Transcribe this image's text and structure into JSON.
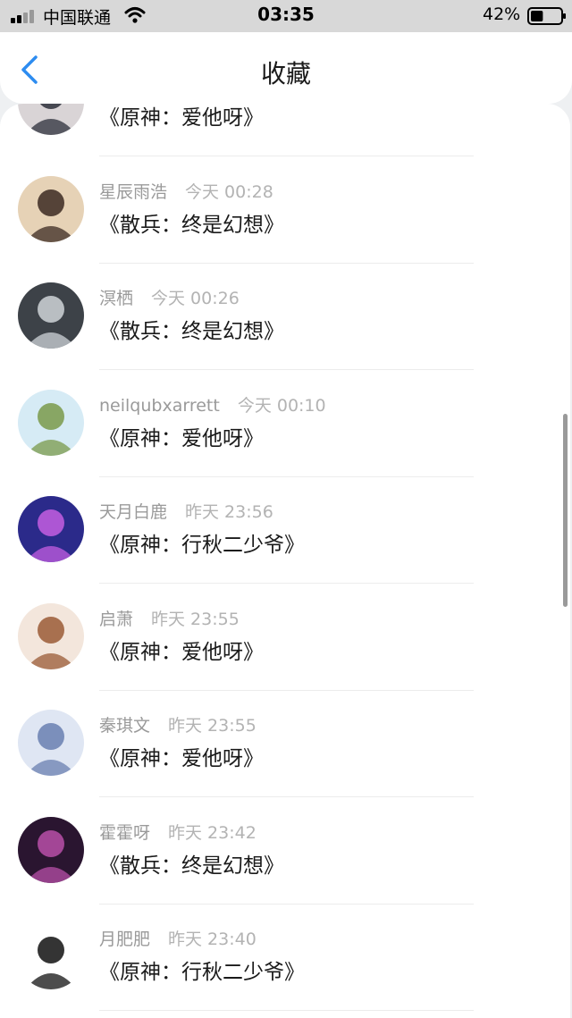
{
  "status_bar": {
    "carrier": "中国联通",
    "time": "03:35",
    "battery": "42%",
    "battery_level": 0.42
  },
  "nav": {
    "title": "收藏",
    "back_icon": "chevron-left-icon"
  },
  "colors": {
    "accent": "#2d8cf0",
    "divider": "#ececec"
  },
  "items": [
    {
      "user": "",
      "time": "",
      "work": "《原神：爱他呀》",
      "avatar": {
        "bg": "#d9d4d6",
        "fg": "#2b2f3a"
      }
    },
    {
      "user": "星辰雨浩",
      "time": "今天 00:28",
      "work": "《散兵：终是幻想》",
      "avatar": {
        "bg": "#e6d2b6",
        "fg": "#3b2a22"
      }
    },
    {
      "user": "溟栖",
      "time": "今天 00:26",
      "work": "《散兵：终是幻想》",
      "avatar": {
        "bg": "#3d4248",
        "fg": "#cfd4d8"
      }
    },
    {
      "user": "neilqubxarrett",
      "time": "今天 00:10",
      "work": "《原神：爱他呀》",
      "avatar": {
        "bg": "#d6ebf5",
        "fg": "#7a9a4a"
      }
    },
    {
      "user": "天月白鹿",
      "time": "昨天 23:56",
      "work": "《原神：行秋二少爷》",
      "avatar": {
        "bg": "#2b2a8a",
        "fg": "#c45ee0"
      }
    },
    {
      "user": "启萧",
      "time": "昨天 23:55",
      "work": "《原神：爱他呀》",
      "avatar": {
        "bg": "#f3e6dc",
        "fg": "#9a5a36"
      }
    },
    {
      "user": "秦琪文",
      "time": "昨天 23:55",
      "work": "《原神：爱他呀》",
      "avatar": {
        "bg": "#dfe6f3",
        "fg": "#6a7fb0"
      }
    },
    {
      "user": "霍霍呀",
      "time": "昨天 23:42",
      "work": "《散兵：终是幻想》",
      "avatar": {
        "bg": "#2a1530",
        "fg": "#b84fa8"
      }
    },
    {
      "user": "月肥肥",
      "time": "昨天 23:40",
      "work": "《原神：行秋二少爷》",
      "avatar": {
        "bg": "#ffffff",
        "fg": "#111111"
      }
    }
  ]
}
